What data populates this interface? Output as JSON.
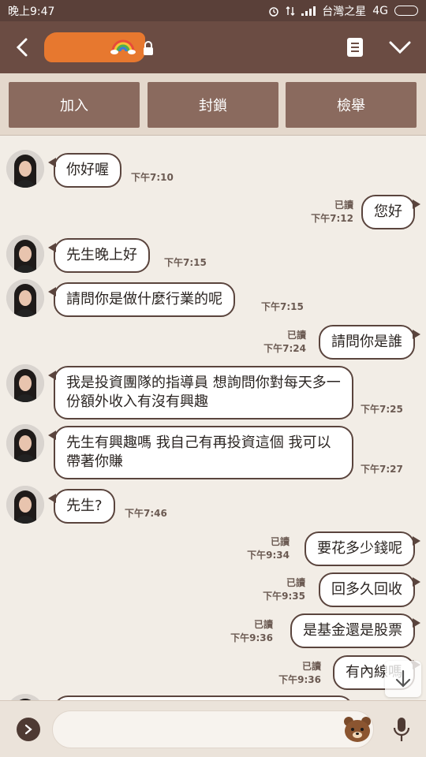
{
  "status_bar": {
    "time": "晚上9:47",
    "carrier": "台灣之星",
    "network": "4G"
  },
  "header": {
    "icons": [
      "back-arrow-icon",
      "rainbow-icon",
      "lock-icon",
      "notes-icon",
      "chevron-down-icon"
    ]
  },
  "actions": {
    "add": "加入",
    "block": "封鎖",
    "report": "檢舉"
  },
  "messages": [
    {
      "side": "in",
      "text": "你好喔",
      "time": "下午7:10"
    },
    {
      "side": "out",
      "text": "您好",
      "read": "已讀",
      "time": "下午7:12"
    },
    {
      "side": "in",
      "text": "先生晚上好",
      "time": "下午7:15"
    },
    {
      "side": "in",
      "text": "請問你是做什麼行業的呢",
      "time": "下午7:15"
    },
    {
      "side": "out",
      "text": "請問你是誰",
      "read": "已讀",
      "time": "下午7:24"
    },
    {
      "side": "in",
      "text": "我是投資團隊的指導員 想詢問你對每天多一份額外收入有沒有興趣",
      "time": "下午7:25"
    },
    {
      "side": "in",
      "text": "先生有興趣嗎 我自己有再投資這個 我可以帶著你賺",
      "time": "下午7:27"
    },
    {
      "side": "in",
      "text": "先生?",
      "time": "下午7:46"
    },
    {
      "side": "out",
      "text": "要花多少錢呢",
      "read": "已讀",
      "time": "下午9:34"
    },
    {
      "side": "out",
      "text": "回多久回收",
      "read": "已讀",
      "time": "下午9:35"
    },
    {
      "side": "out",
      "text": "是基金還是股票",
      "read": "已讀",
      "time": "下午9:36"
    },
    {
      "side": "out",
      "text": "有內線嗎",
      "read": "已讀",
      "time": "下午9:36"
    }
  ],
  "input": {
    "placeholder": "",
    "value": ""
  },
  "colors": {
    "header": "#6b4c43",
    "status_bar": "#5a4039",
    "action_button": "#8a6a5e",
    "chat_bg": "#f2ede6",
    "bubble_border": "#5a443d",
    "redaction": "#f27c2e"
  }
}
